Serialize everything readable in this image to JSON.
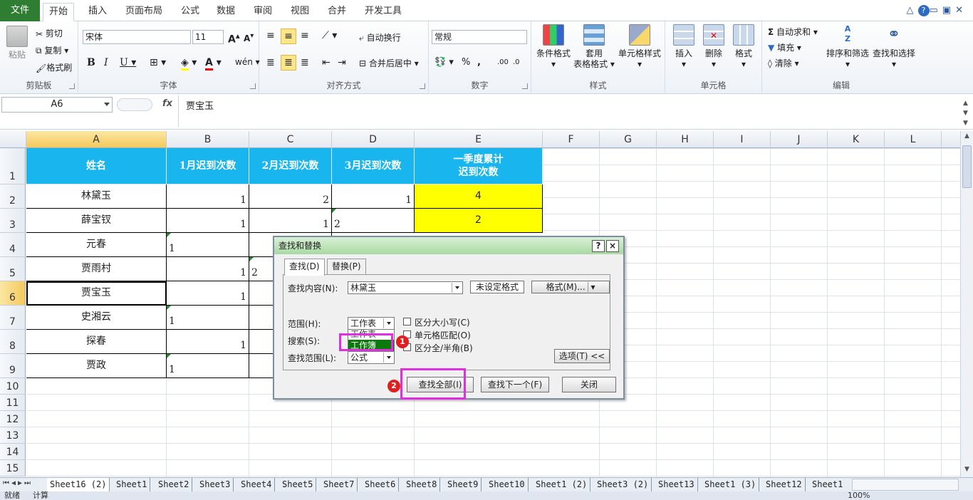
{
  "tabs": {
    "file": "文件",
    "items": [
      "开始",
      "插入",
      "页面布局",
      "公式",
      "数据",
      "审阅",
      "视图",
      "合并",
      "开发工具"
    ],
    "active_index": 0
  },
  "ribbon": {
    "clipboard": {
      "label": "剪贴板",
      "paste": "粘贴",
      "cut": "剪切",
      "copy": "复制",
      "format_painter": "格式刷"
    },
    "font": {
      "label": "字体",
      "font_name": "宋体",
      "font_size": "11"
    },
    "alignment": {
      "label": "对齐方式",
      "wrap_text": "自动换行",
      "merge_center": "合并后居中"
    },
    "number": {
      "label": "数字",
      "format": "常规"
    },
    "styles": {
      "label": "样式",
      "conditional": "条件格式",
      "table_style_1": "套用",
      "table_style_2": "表格格式",
      "cell_style": "单元格样式"
    },
    "cells": {
      "label": "单元格",
      "insert": "插入",
      "delete": "删除",
      "format": "格式"
    },
    "editing": {
      "label": "编辑",
      "autosum": "自动求和",
      "fill": "填充",
      "clear": "清除",
      "sort_filter": "排序和筛选",
      "find_select": "查找和选择"
    }
  },
  "formula_bar": {
    "name_box": "A6",
    "fx": "fx",
    "content": "贾宝玉"
  },
  "columns": [
    "A",
    "B",
    "C",
    "D",
    "E",
    "F",
    "G",
    "H",
    "I",
    "J",
    "K",
    "L"
  ],
  "rows": [
    "1",
    "2",
    "3",
    "4",
    "5",
    "6",
    "7",
    "8",
    "9",
    "10",
    "11",
    "12",
    "13",
    "14",
    "15"
  ],
  "table": {
    "headers": [
      "姓名",
      "1月迟到次数",
      "2月迟到次数",
      "3月迟到次数",
      "一季度累计\n迟到次数"
    ],
    "rows": [
      [
        "林黛玉",
        "1",
        "2",
        "1",
        "4"
      ],
      [
        "薛宝钗",
        "1",
        "1",
        "2",
        "2"
      ],
      [
        "元春",
        "1",
        "",
        "",
        ""
      ],
      [
        "贾雨村",
        "1",
        "2",
        "",
        ""
      ],
      [
        "贾宝玉",
        "1",
        "",
        "",
        ""
      ],
      [
        "史湘云",
        "1",
        "",
        "",
        ""
      ],
      [
        "探春",
        "1",
        "",
        "",
        ""
      ],
      [
        "贾政",
        "1",
        "",
        "",
        ""
      ]
    ]
  },
  "sheet_tabs": [
    "Sheet16 (2)",
    "Sheet1",
    "Sheet2",
    "Sheet3",
    "Sheet4",
    "Sheet5",
    "Sheet7",
    "Sheet6",
    "Sheet8",
    "Sheet9",
    "Sheet10",
    "Sheet1 (2)",
    "Sheet3 (2)",
    "Sheet13",
    "Sheet1 (3)",
    "Sheet12",
    "Sheet1"
  ],
  "status": {
    "ready": "就绪",
    "calc": "计算",
    "zoom": "100%"
  },
  "dialog": {
    "title": "查找和替换",
    "help": "?",
    "close_x": "×",
    "tab_find": "查找(D)",
    "tab_replace": "替换(P)",
    "find_what_label": "查找内容(N):",
    "find_what_value": "林黛玉",
    "no_format": "未设定格式",
    "format_btn": "格式(M)...",
    "within_label": "范围(H):",
    "within_value": "工作表",
    "within_option_sheet": "工作表",
    "within_option_workbook": "工作簿",
    "search_label": "搜索(S):",
    "lookin_label": "查找范围(L):",
    "lookin_value": "公式",
    "match_case": "区分大小写(C)",
    "match_cell": "单元格匹配(O)",
    "match_byte": "区分全/半角(B)",
    "options_btn": "选项(T) <<",
    "find_all": "查找全部(I)",
    "find_next": "查找下一个(F)",
    "close": "关闭",
    "badge1": "1",
    "badge2": "2"
  },
  "colors": {
    "header_blue": "#19b5ef",
    "highlight_yellow": "#ffff00",
    "annotation_magenta": "#e02fe0",
    "file_tab_green": "#2f7d32"
  }
}
